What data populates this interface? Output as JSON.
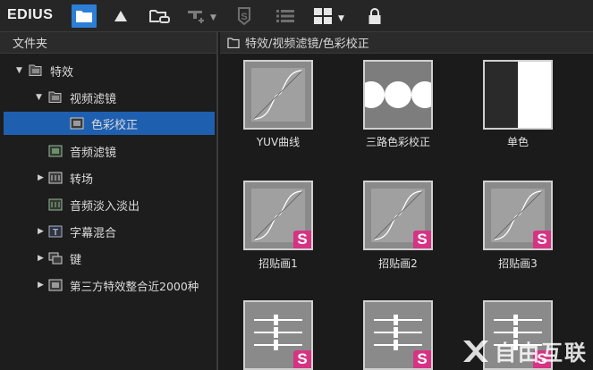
{
  "app": {
    "brand": "EDIUS"
  },
  "toolbar": {
    "icons": [
      "folder-icon",
      "triangle-icon",
      "link-folder-icon",
      "add-effect-icon",
      "s-shield-icon",
      "list-view-icon",
      "grid-view-icon",
      "lock-icon"
    ]
  },
  "left_panel": {
    "title": "文件夹"
  },
  "tree": [
    {
      "label": "特效",
      "expanded": true
    },
    {
      "label": "视频滤镜",
      "expanded": true
    },
    {
      "label": "色彩校正",
      "selected": true
    },
    {
      "label": "音频滤镜"
    },
    {
      "label": "转场",
      "collapsed": true
    },
    {
      "label": "音频淡入淡出"
    },
    {
      "label": "字幕混合",
      "collapsed": true
    },
    {
      "label": "键",
      "collapsed": true
    },
    {
      "label": "第三方特效整合近2000种",
      "collapsed": true
    }
  ],
  "right_panel": {
    "path": "特效/视频滤镜/色彩校正"
  },
  "effects": [
    {
      "label": "YUV曲线",
      "thumb": "curve"
    },
    {
      "label": "三路色彩校正",
      "thumb": "circles"
    },
    {
      "label": "单色",
      "thumb": "mono"
    },
    {
      "label": "招贴画1",
      "thumb": "curve-s"
    },
    {
      "label": "招贴画2",
      "thumb": "curve-s"
    },
    {
      "label": "招贴画3",
      "thumb": "curve-s"
    },
    {
      "label": "",
      "thumb": "sliders-s"
    },
    {
      "label": "",
      "thumb": "sliders-s"
    },
    {
      "label": "",
      "thumb": "sliders-s"
    }
  ],
  "badge": {
    "letter": "S",
    "color": "#d63384"
  },
  "colors": {
    "accent": "#2c7fd6",
    "selection": "#1f5fb0"
  },
  "watermark": {
    "text": "自由互联"
  }
}
